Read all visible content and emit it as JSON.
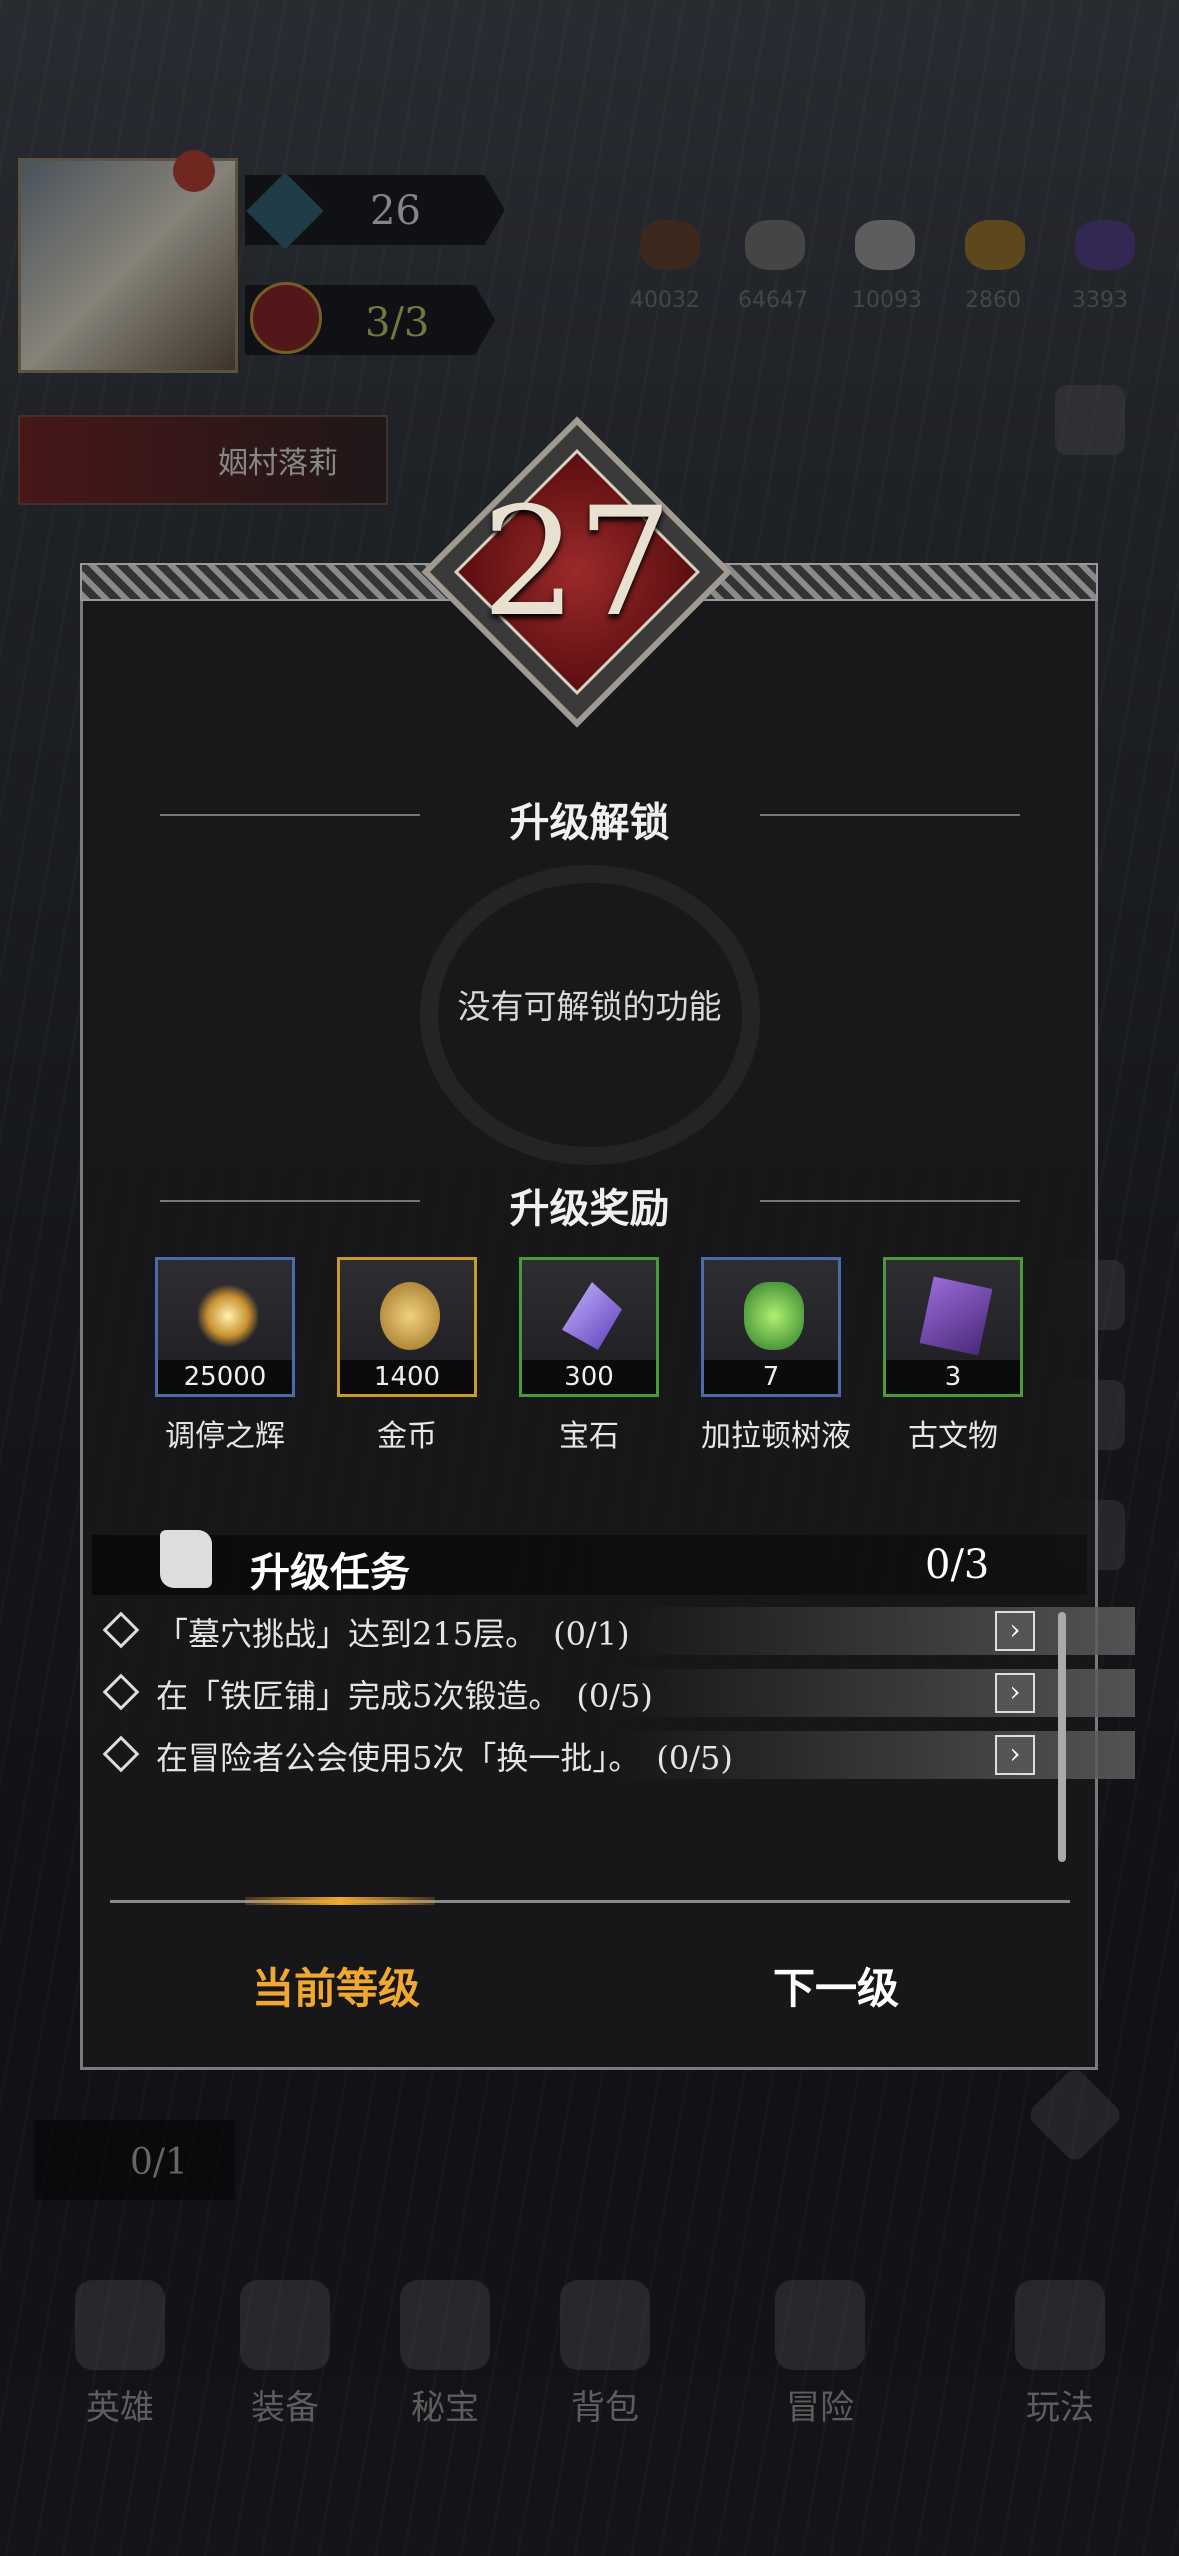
{
  "hud": {
    "player_level": "26",
    "energy": "3/3",
    "resources": [
      {
        "name": "wood",
        "value": "40032",
        "color": "#5a3a28"
      },
      {
        "name": "ore",
        "value": "64647",
        "color": "#666666"
      },
      {
        "name": "iron",
        "value": "10093",
        "color": "#8a8a8a"
      },
      {
        "name": "gold",
        "value": "2860",
        "color": "#8a6a28"
      },
      {
        "name": "gem",
        "value": "3393",
        "color": "#4a3a7a"
      }
    ],
    "event_title": "姻村落莉"
  },
  "dialog": {
    "level": "27",
    "unlock_title": "升级解锁",
    "unlock_empty": "没有可解锁的功能",
    "reward_title": "升级奖励",
    "rewards": [
      {
        "name": "调停之辉",
        "count": "25000",
        "border": "#4a6aa8",
        "icon": "radiance-icon"
      },
      {
        "name": "金币",
        "count": "1400",
        "border": "#c89a2a",
        "icon": "gold-coin-icon"
      },
      {
        "name": "宝石",
        "count": "300",
        "border": "#4a9a3a",
        "icon": "gem-icon"
      },
      {
        "name": "加拉顿树液",
        "count": "7",
        "border": "#4a6aa8",
        "icon": "sap-potion-icon"
      },
      {
        "name": "古文物",
        "count": "3",
        "border": "#4a9a3a",
        "icon": "artifact-icon"
      }
    ],
    "task_title": "升级任务",
    "task_progress": "0/3",
    "tasks": [
      {
        "text": "「墓穴挑战」达到215层。　(0/1)"
      },
      {
        "text": "在「铁匠铺」完成5次锻造。　(0/5)"
      },
      {
        "text": "在冒险者公会使用5次「换一批」。　(0/5)"
      }
    ],
    "tabs": {
      "current": "当前等级",
      "next": "下一级"
    },
    "active_tab_color": "#f0a830"
  },
  "bottom": {
    "counter": "0/1",
    "nav": [
      {
        "label": "英雄"
      },
      {
        "label": "装备"
      },
      {
        "label": "秘宝"
      },
      {
        "label": "背包"
      },
      {
        "label": "冒险"
      },
      {
        "label": "玩法"
      }
    ]
  }
}
